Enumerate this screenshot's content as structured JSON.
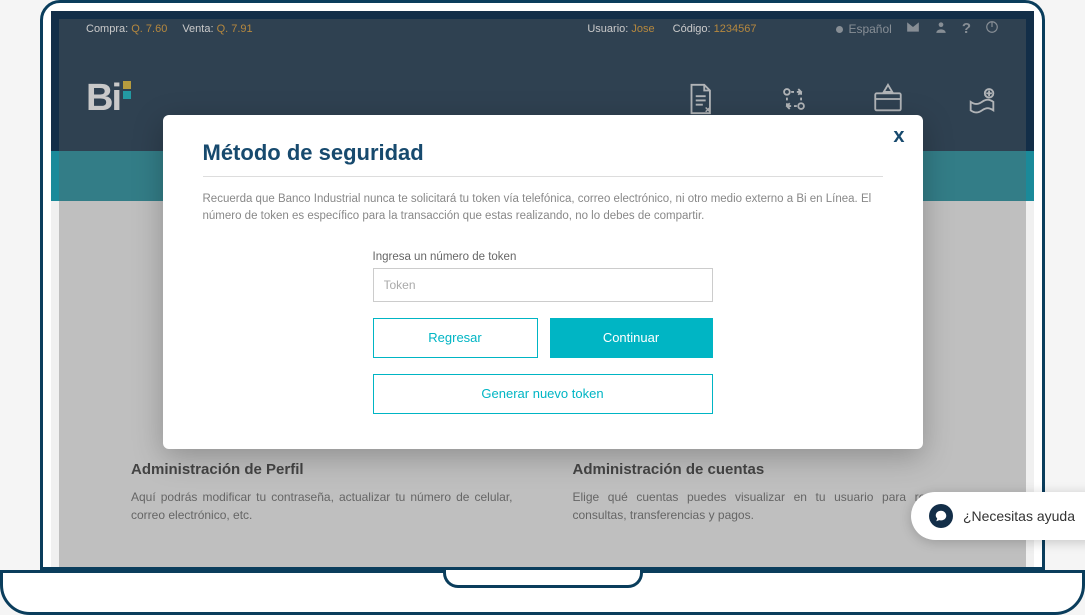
{
  "topbar": {
    "compra_label": "Compra:",
    "compra_value": "Q. 7.60",
    "venta_label": "Venta:",
    "venta_value": "Q. 7.91",
    "usuario_label": "Usuario:",
    "usuario_value": "Jose",
    "codigo_label": "Código:",
    "codigo_value": "1234567",
    "language": "Español"
  },
  "cards": {
    "perfil": {
      "title": "Administración de Perfil",
      "desc": "Aquí podrás modificar tu contraseña, actualizar tu número de celular, correo electrónico, etc."
    },
    "cuentas": {
      "title": "Administración de cuentas",
      "desc": "Elige qué cuentas puedes visualizar en tu usuario para realizar consultas, transferencias y pagos."
    }
  },
  "modal": {
    "title": "Método de seguridad",
    "desc": "Recuerda que Banco Industrial nunca te solicitará tu token vía telefónica, correo electrónico, ni otro medio externo a Bi en Línea. El número de token es específico para la transacción que estas realizando, no lo debes de compartir.",
    "field_label": "Ingresa un número de token",
    "placeholder": "Token",
    "back_label": "Regresar",
    "continue_label": "Continuar",
    "generate_label": "Generar nuevo token",
    "close": "x"
  },
  "help": {
    "text": "¿Necesitas ayuda"
  },
  "logo": {
    "text": "Bi"
  }
}
